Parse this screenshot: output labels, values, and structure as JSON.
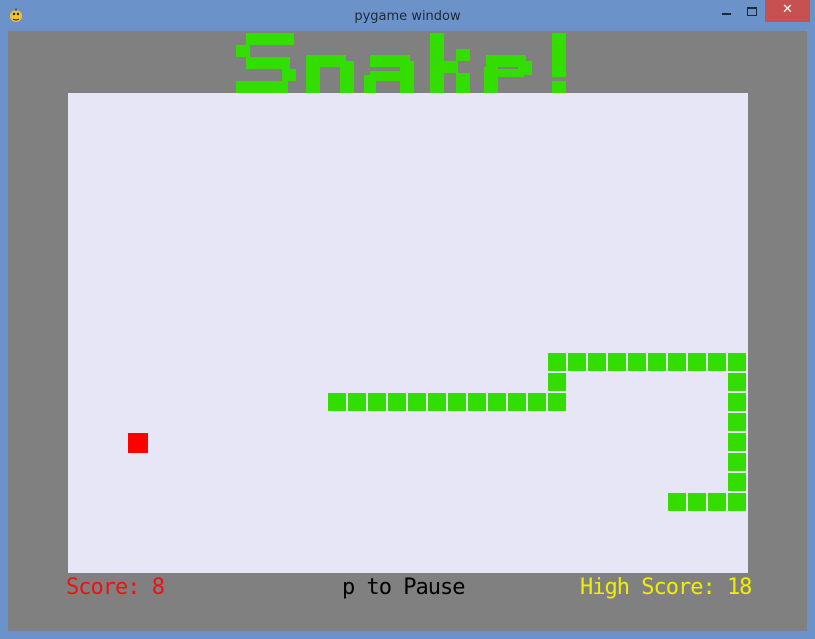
{
  "window": {
    "title": "pygame window",
    "controls": {
      "minimize": "minimize",
      "maximize": "maximize",
      "close": "✕"
    }
  },
  "game": {
    "logo_text": "Snake!",
    "colors": {
      "snake": "#33dd00",
      "food": "#ff0000",
      "board": "#e6e6f7",
      "border": "#808080"
    },
    "status": {
      "score_label": "Score: 8",
      "pause_hint": "p to Pause",
      "high_score_label": "High Score: 18"
    }
  }
}
